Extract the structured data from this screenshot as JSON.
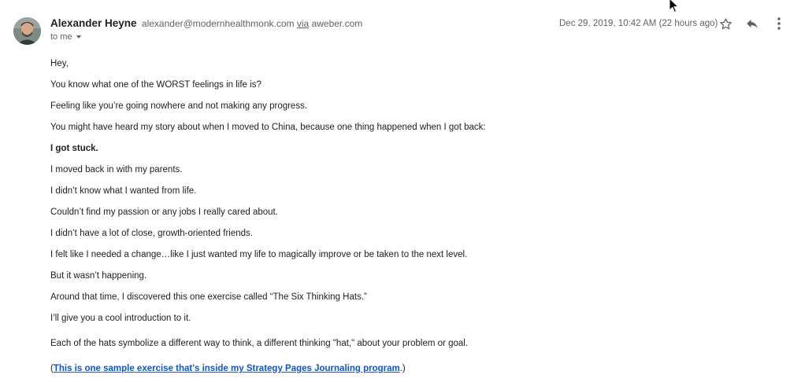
{
  "sender": {
    "name": "Alexander Heyne",
    "email": "alexander@modernhealthmonk.com",
    "via_label": "via",
    "via_domain": "aweber.com"
  },
  "recipient": {
    "label": "to me"
  },
  "date": "Dec 29, 2019, 10:42 AM (22 hours ago)",
  "toolbar": {
    "icons": [
      "star-icon",
      "reply-icon",
      "more-vertical-icon"
    ]
  },
  "body": {
    "paragraphs": [
      "Hey,",
      "You know what one of the WORST feelings in life is?",
      "Feeling like you’re going nowhere and not making any progress.",
      "You might have heard my story about when I moved to China, because one thing happened when I got back:",
      "I got stuck.",
      "I moved back in with my parents.",
      "I didn’t know what I wanted from life.",
      "Couldn’t find my passion or any jobs I really cared about.",
      "I didn’t have a lot of close, growth-oriented friends.",
      "I felt like I needed a change…like I just wanted my life to magically improve or be taken to the next level.",
      "But it wasn’t happening.",
      "Around that time, I discovered this one exercise called “The Six Thinking Hats.”",
      "I’ll give you a cool introduction to it.",
      "Each of the hats symbolize a different way to think, a different thinking \"hat,\" about your problem or goal."
    ],
    "link_prefix": "(",
    "link_text": "This is one sample exercise that's inside my Strategy Pages Journaling program",
    "link_suffix": ".)"
  },
  "colors": {
    "link": "#1155cc",
    "text": "#202124",
    "muted": "#5f6368"
  }
}
